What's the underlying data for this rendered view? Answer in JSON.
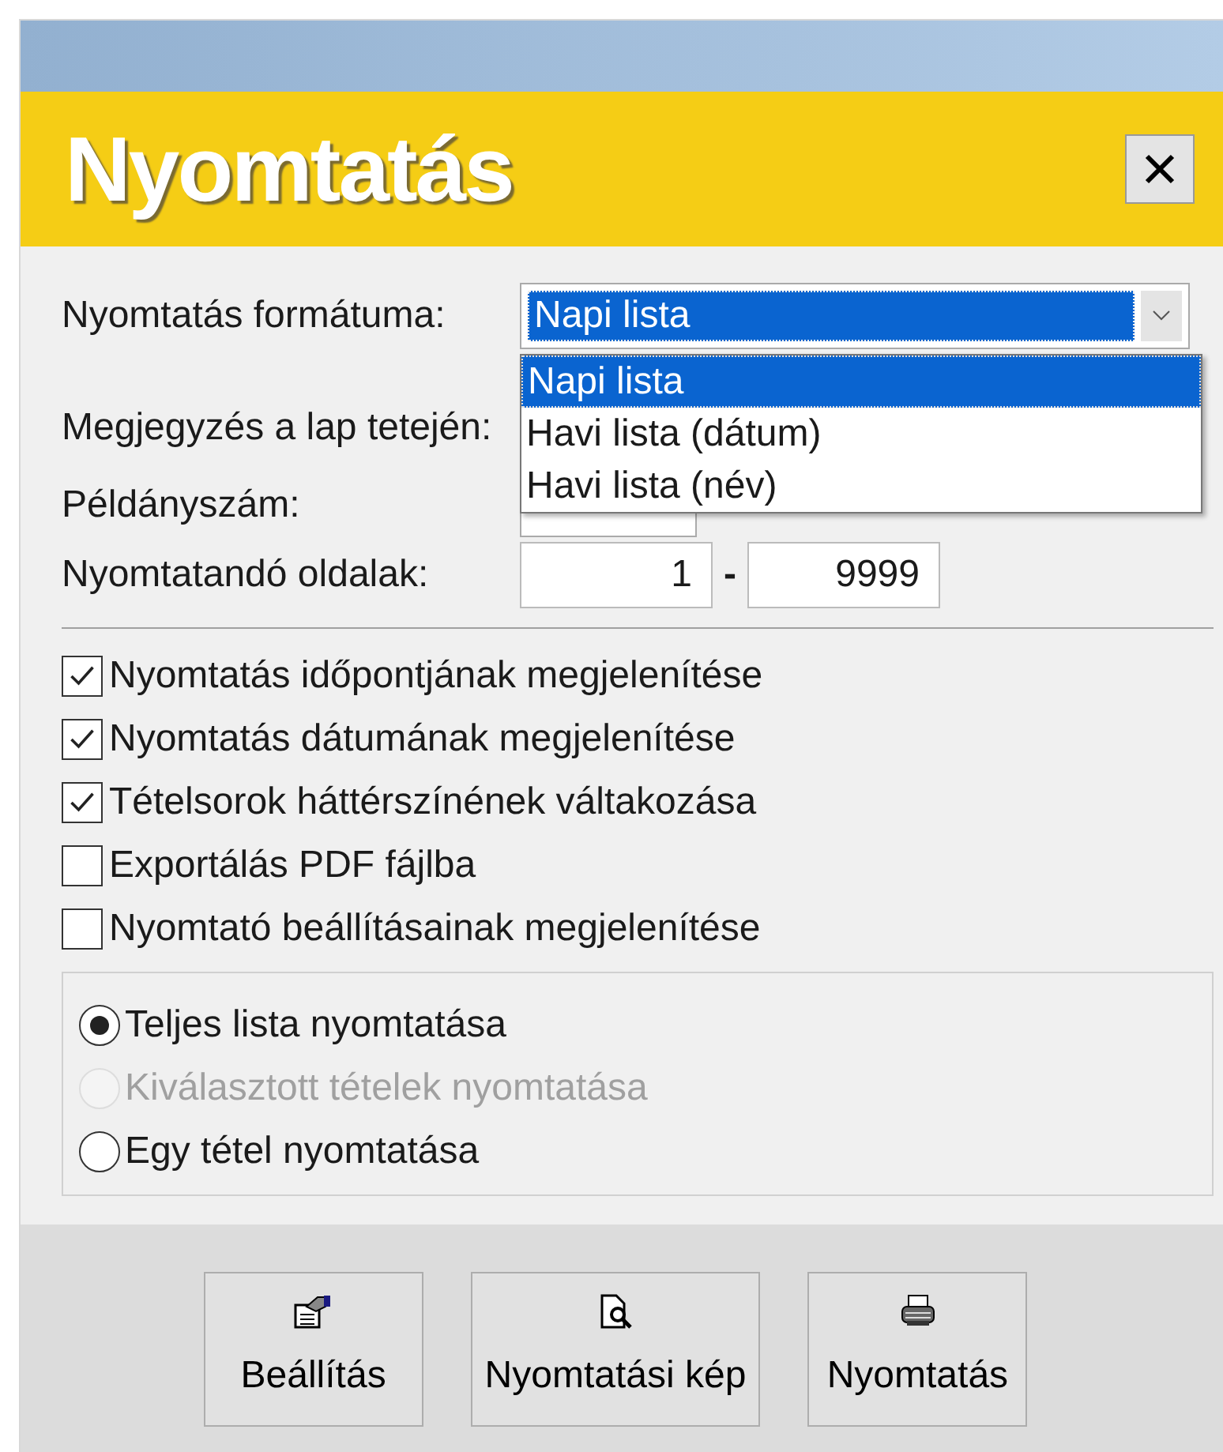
{
  "window": {
    "title": "Nyomtatás"
  },
  "format": {
    "label": "Nyomtatás formátuma:",
    "value": "Napi lista",
    "expanded": true,
    "options": [
      {
        "label": "Napi lista",
        "selected": true
      },
      {
        "label": "Havi lista (dátum)",
        "selected": false
      },
      {
        "label": "Havi lista (név)",
        "selected": false
      }
    ]
  },
  "note": {
    "label": "Megjegyzés a lap tetején:"
  },
  "copies": {
    "label": "Példányszám:"
  },
  "pages": {
    "label": "Nyomtatandó oldalak:",
    "from": "1",
    "separator": "-",
    "to": "9999"
  },
  "options": [
    {
      "label": "Nyomtatás időpontjának megjelenítése",
      "checked": true
    },
    {
      "label": "Nyomtatás dátumának megjelenítése",
      "checked": true
    },
    {
      "label": "Tételsorok háttérszínének váltakozása",
      "checked": true
    },
    {
      "label": "Exportálás PDF fájlba",
      "checked": false
    },
    {
      "label": "Nyomtató beállításainak megjelenítése",
      "checked": false
    }
  ],
  "scope": [
    {
      "label": "Teljes lista nyomtatása",
      "selected": true,
      "disabled": false
    },
    {
      "label": "Kiválasztott tételek nyomtatása",
      "selected": false,
      "disabled": true
    },
    {
      "label": "Egy tétel nyomtatása",
      "selected": false,
      "disabled": false
    }
  ],
  "buttons": [
    {
      "kind": "settings",
      "label": "Beállítás"
    },
    {
      "kind": "preview",
      "label": "Nyomtatási kép"
    },
    {
      "kind": "print",
      "label": "Nyomtatás"
    }
  ]
}
